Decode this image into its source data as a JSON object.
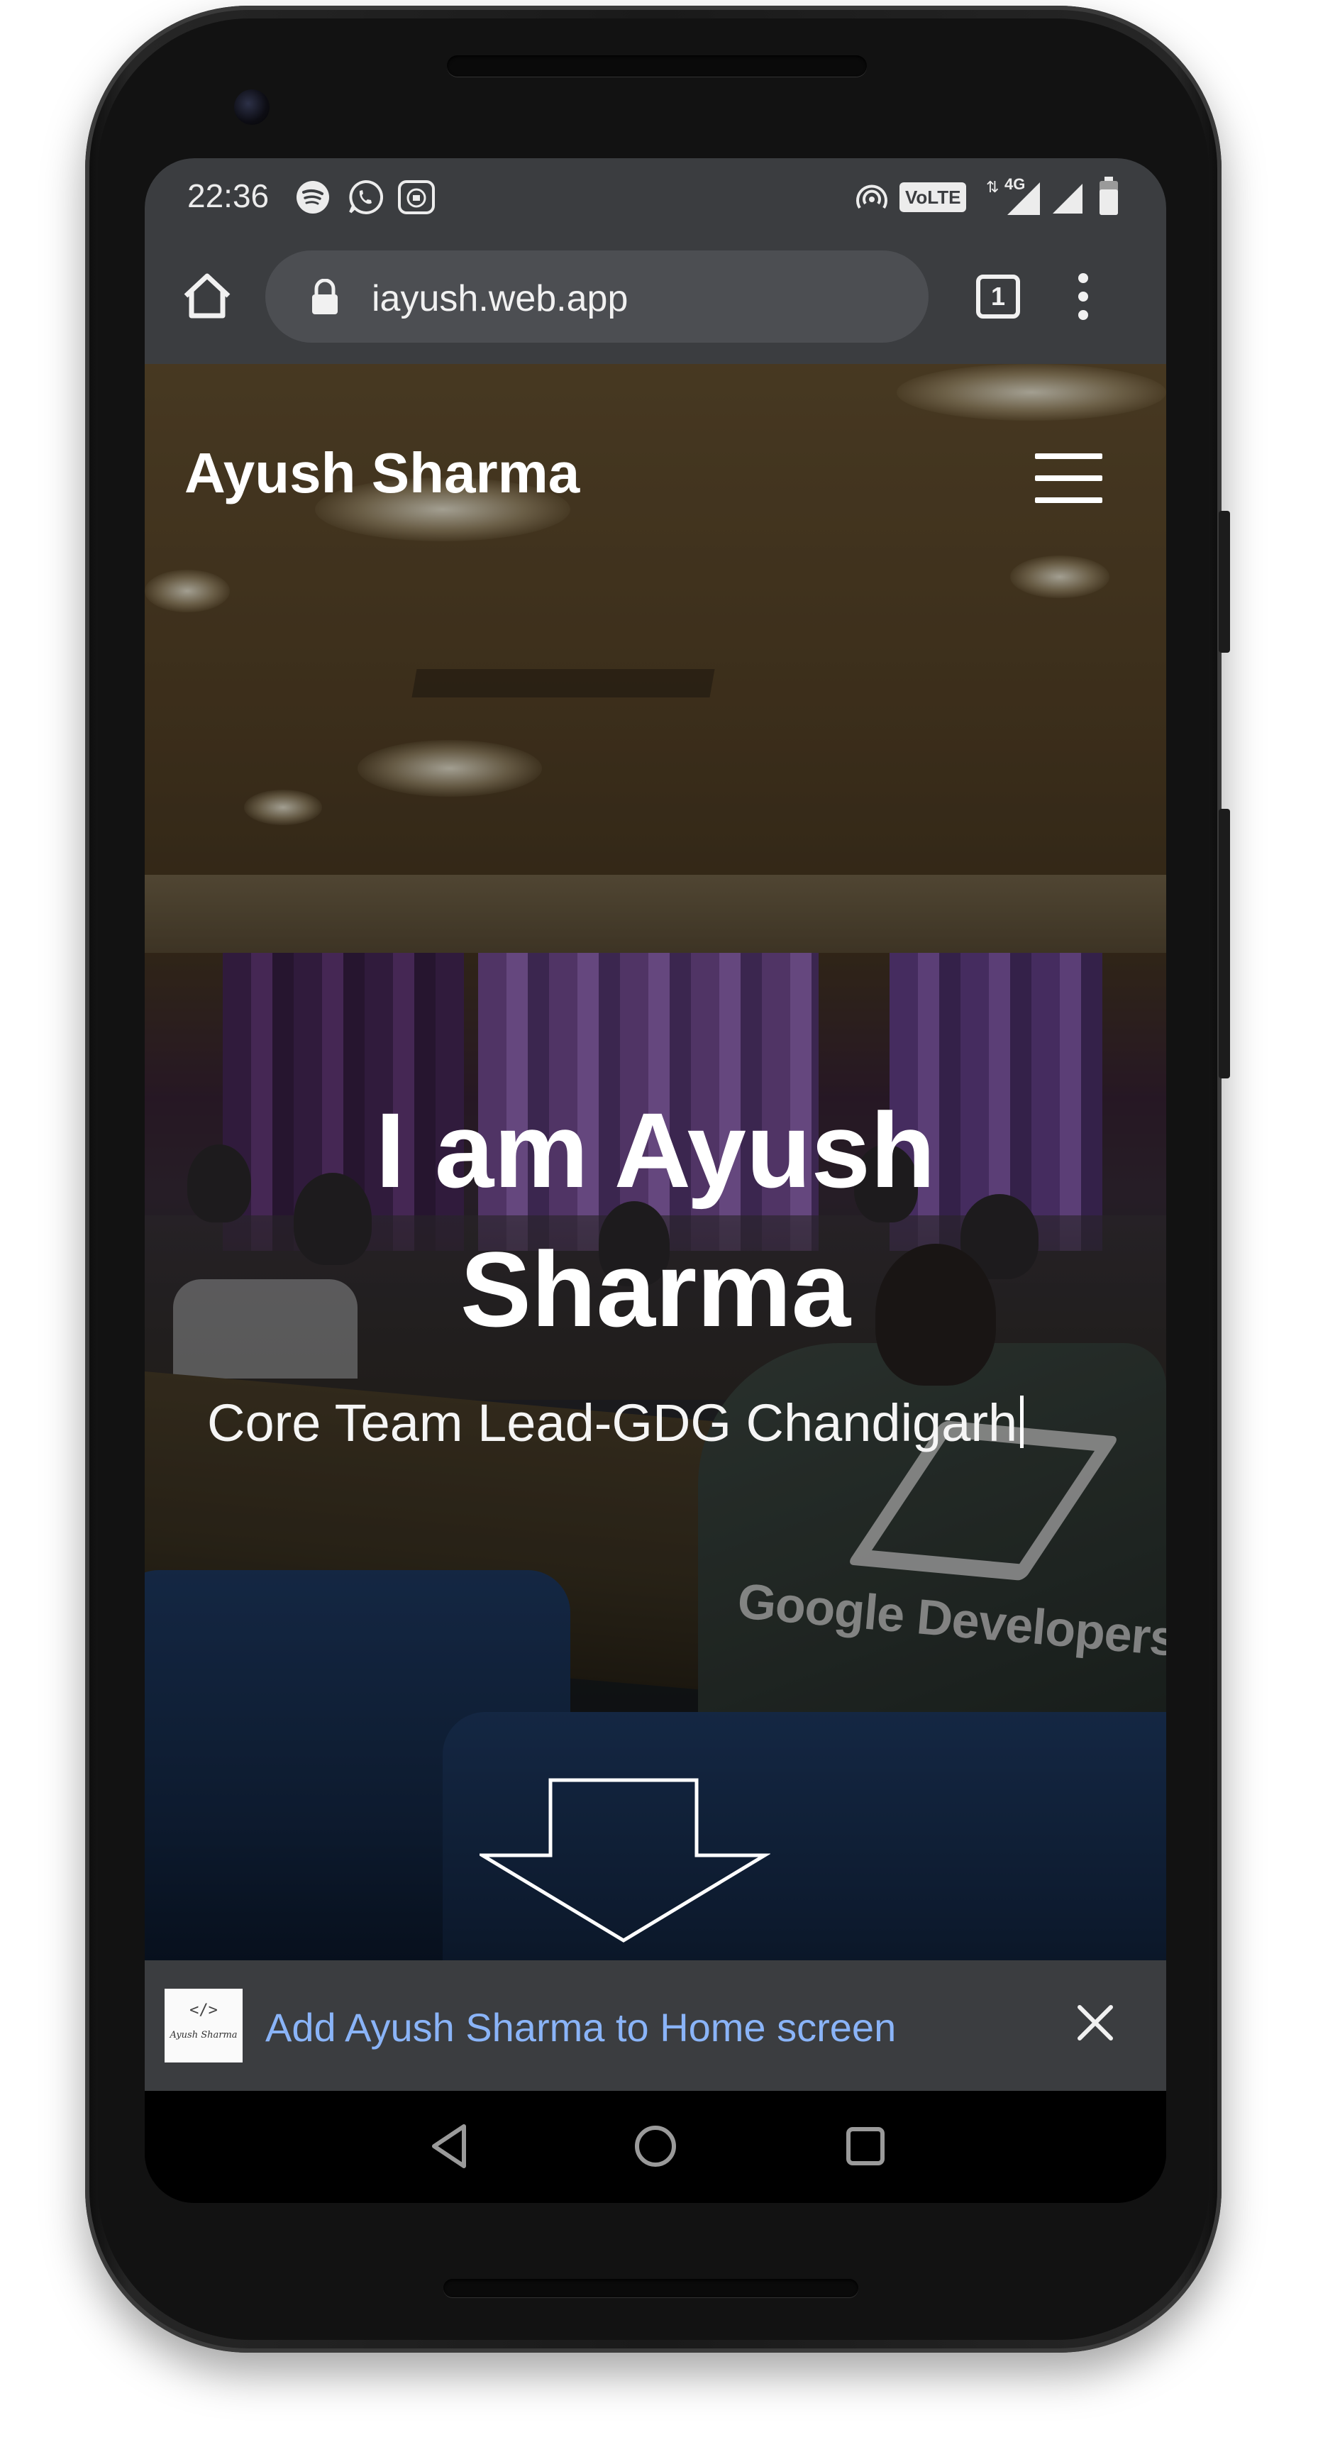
{
  "status_bar": {
    "time": "22:36",
    "left_icons": [
      "spotify-icon",
      "whatsapp-icon",
      "mi-app-icon"
    ],
    "right_icons": [
      "hotspot-icon",
      "volte-icon",
      "data-arrows-icon",
      "4g-signal-icon",
      "signal-icon",
      "battery-icon"
    ],
    "volte_label": "VoLTE",
    "network_label": "4G"
  },
  "browser": {
    "url": "iayush.web.app",
    "tab_count": "1"
  },
  "site": {
    "brand": "Ayush Sharma",
    "headline_line1": "I am Ayush",
    "headline_line2": "Sharma",
    "subtitle": "Core Team Lead-GDG Chandigarh",
    "hero_background_text": "Google Developers"
  },
  "add_to_home": {
    "label": "Add Ayush Sharma to Home screen",
    "icon_caption": "Ayush Sharma",
    "icon_code": "</>"
  },
  "colors": {
    "browser_bar": "#3b3d40",
    "banner_link": "#8ab4f8",
    "text": "#ffffff"
  }
}
